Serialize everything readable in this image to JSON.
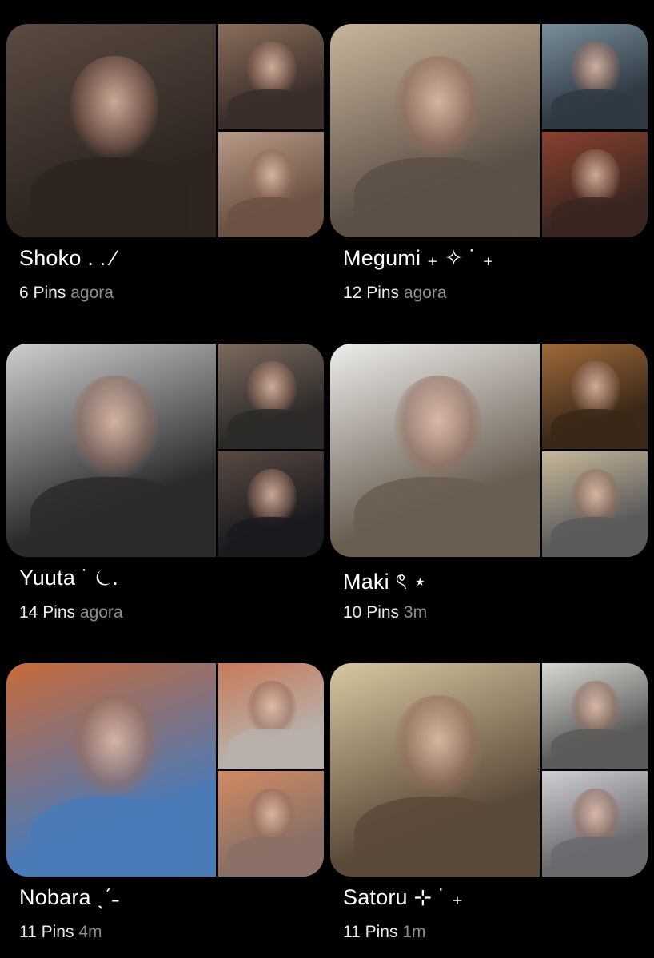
{
  "boards": [
    {
      "title": "Shoko . . ⁄",
      "pin_count": "6 Pins",
      "time": "agora",
      "colors": {
        "main": [
          "#2e2520",
          "#5a4a42"
        ],
        "top": [
          "#3a2e2a",
          "#8a6e5c"
        ],
        "bot": [
          "#6b5244",
          "#b89a86"
        ]
      }
    },
    {
      "title": "Megumi ₊ ✧ ˙ ₊",
      "pin_count": "12 Pins",
      "time": "agora",
      "colors": {
        "main": [
          "#5c5047",
          "#c9b59c"
        ],
        "top": [
          "#2f3a44",
          "#7a8e9a"
        ],
        "bot": [
          "#3a2620",
          "#8a4030"
        ]
      }
    },
    {
      "title": "Yuuta ˙ ⏾.",
      "pin_count": "14 Pins",
      "time": "agora",
      "colors": {
        "main": [
          "#2b2b2e",
          "#cfcfcf"
        ],
        "top": [
          "#2c2a28",
          "#7c6a5e"
        ],
        "bot": [
          "#1a1a1e",
          "#5a4a42"
        ]
      }
    },
    {
      "title": "Maki ৎ ⋆",
      "pin_count": "10 Pins",
      "time": "3m",
      "colors": {
        "main": [
          "#6a5e52",
          "#ededea"
        ],
        "top": [
          "#3a2818",
          "#a06a3a"
        ],
        "bot": [
          "#5a5a5a",
          "#c8b89a"
        ]
      }
    },
    {
      "title": "Nobara ˎˊ˗",
      "pin_count": "11 Pins",
      "time": "4m",
      "colors": {
        "main": [
          "#4a7ab8",
          "#c86a3a"
        ],
        "top": [
          "#b8b0aa",
          "#c87a58"
        ],
        "bot": [
          "#8a7066",
          "#d08a62"
        ]
      }
    },
    {
      "title": "Satoru ⊹ ˙ ₊",
      "pin_count": "11 Pins",
      "time": "1m",
      "colors": {
        "main": [
          "#5a4a3a",
          "#d8c8a0"
        ],
        "top": [
          "#5a5a5a",
          "#d8d8d2"
        ],
        "bot": [
          "#6a6a6e",
          "#d0d0d4"
        ]
      }
    }
  ]
}
